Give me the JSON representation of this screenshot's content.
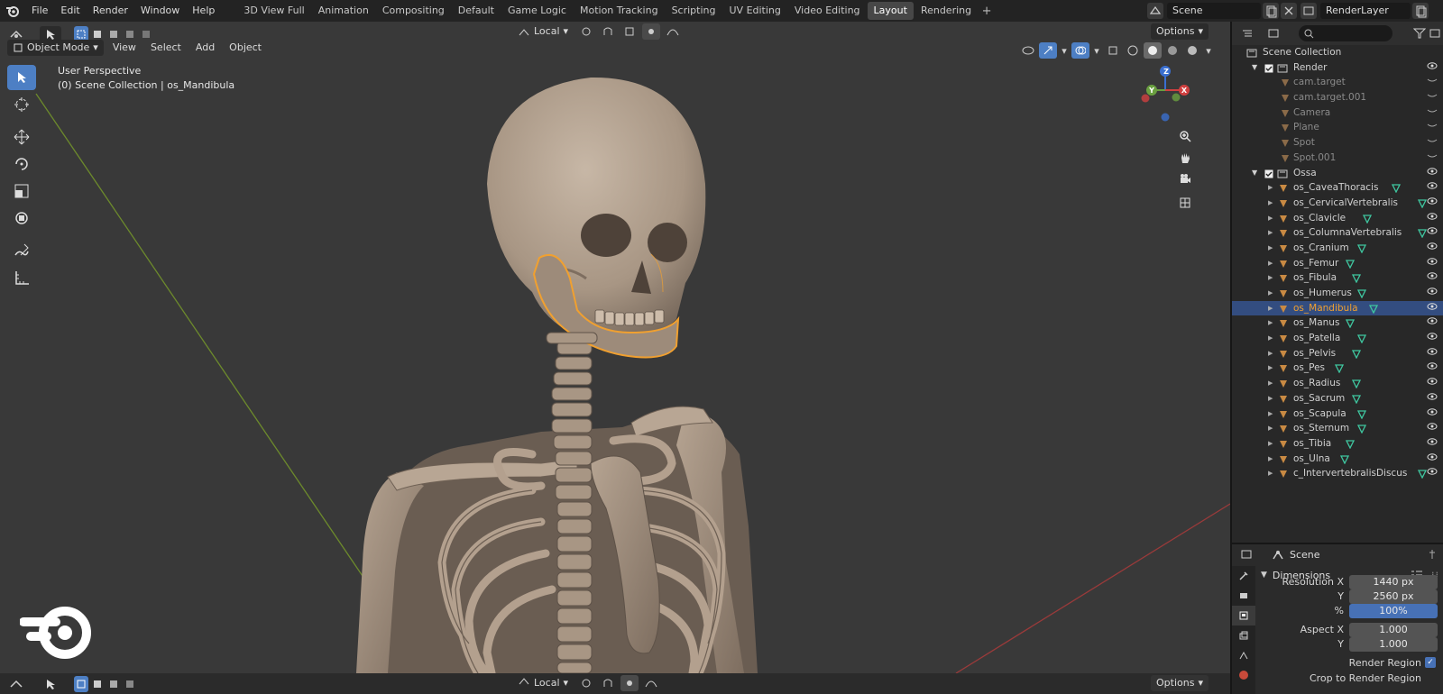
{
  "topbar": {
    "menus": [
      "File",
      "Edit",
      "Render",
      "Window",
      "Help"
    ],
    "workspaces": [
      "3D View Full",
      "Animation",
      "Compositing",
      "Default",
      "Game Logic",
      "Motion Tracking",
      "Scripting",
      "UV Editing",
      "Video Editing",
      "Layout",
      "Rendering"
    ],
    "active_workspace": "Layout",
    "scene": "Scene",
    "view_layer": "RenderLayer"
  },
  "viewport": {
    "mode": "Object Mode",
    "menus": [
      "View",
      "Select",
      "Add",
      "Object"
    ],
    "transform_orientation": "Local",
    "options_label": "Options",
    "info_line1": "User Perspective",
    "info_line2": "(0) Scene Collection | os_Mandibula",
    "gizmo_axes": {
      "x": "X",
      "y": "Y",
      "z": "Z"
    }
  },
  "bottombar": {
    "transform_orientation": "Local",
    "options_label": "Options"
  },
  "outliner": {
    "root": "Scene Collection",
    "render_collection": {
      "name": "Render",
      "items": [
        "cam.target",
        "cam.target.001",
        "Camera",
        "Plane",
        "Spot",
        "Spot.001"
      ]
    },
    "ossa_collection": {
      "name": "Ossa",
      "items": [
        "os_CaveaThoracis",
        "os_CervicalVertebralis",
        "os_Clavicle",
        "os_ColumnaVertebralis",
        "os_Cranium",
        "os_Femur",
        "os_Fibula",
        "os_Humerus",
        "os_Mandibula",
        "os_Manus",
        "os_Patella",
        "os_Pelvis",
        "os_Pes",
        "os_Radius",
        "os_Sacrum",
        "os_Scapula",
        "os_Sternum",
        "os_Tibia",
        "os_Ulna",
        "c_IntervertebralisDiscus"
      ]
    },
    "selected": "os_Mandibula"
  },
  "properties": {
    "context": "Scene",
    "panel": "Dimensions",
    "resolution_x_label": "Resolution X",
    "resolution_x": "1440 px",
    "resolution_y_label": "Y",
    "resolution_y": "2560 px",
    "percent_label": "%",
    "percent": "100%",
    "aspect_x_label": "Aspect X",
    "aspect_x": "1.000",
    "aspect_y_label": "Y",
    "aspect_y": "1.000",
    "render_region": "Render Region",
    "crop_region": "Crop to Render Region"
  },
  "colors": {
    "selection_blue": "#4d7fc4",
    "outline_orange": "#f0a030",
    "mesh_icon_green": "#3fc7a0",
    "bone_color": "#a89684"
  }
}
